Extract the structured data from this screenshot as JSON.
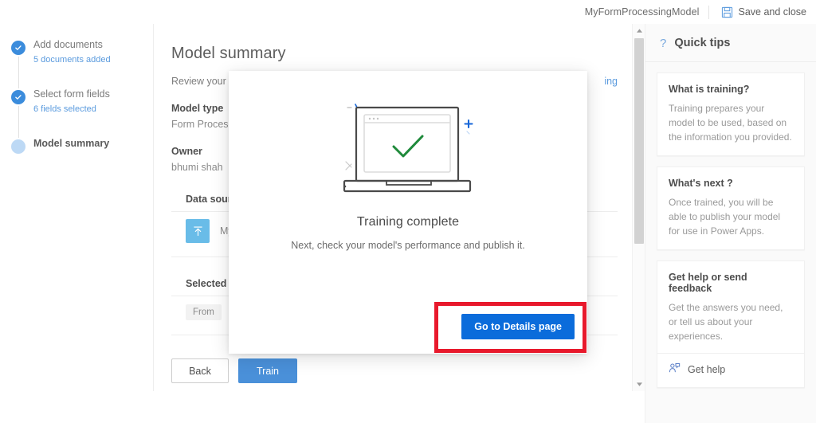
{
  "topbar": {
    "model_name": "MyFormProcessingModel",
    "save_label": "Save and close",
    "save_icon": "save-floppy-icon"
  },
  "wizard": {
    "steps": [
      {
        "title": "Add documents",
        "sub": "5 documents added",
        "state": "complete"
      },
      {
        "title": "Select form fields",
        "sub": "6 fields selected",
        "state": "complete"
      },
      {
        "title": "Model summary",
        "sub": "",
        "state": "current"
      }
    ]
  },
  "main": {
    "heading": "Model summary",
    "review_text": "Review your m",
    "review_link": "ing",
    "model_type_label": "Model type",
    "model_type_value": "Form Process",
    "owner_label": "Owner",
    "owner_value": "bhumi shah",
    "data_source_label": "Data source",
    "data_source_icon": "upload-icon",
    "data_source_value": "My d",
    "selected_fields_label": "Selected field",
    "field_chips": [
      "From"
    ],
    "back_label": "Back",
    "train_label": "Train"
  },
  "scrollbar": {
    "up_icon": "scroll-up-arrow-icon",
    "down_icon": "scroll-down-arrow-icon"
  },
  "tips": {
    "icon": "question-mark-icon",
    "title": "Quick tips",
    "cards": [
      {
        "heading": "What is training?",
        "body": "Training prepares your model to be used, based on the information you provided."
      },
      {
        "heading": "What's next ?",
        "body": "Once trained, you will be able to publish your model for use in Power Apps."
      },
      {
        "heading": "Get help or send feedback",
        "body": "Get the answers you need, or tell us about your experiences.",
        "link_label": "Get help",
        "link_icon": "get-help-person-icon"
      }
    ]
  },
  "modal": {
    "illustration": "laptop-with-checkmark-illustration",
    "title": "Training complete",
    "subtitle": "Next, check your model's performance and publish it.",
    "primary_label": "Go to Details page"
  },
  "colors": {
    "accent_blue": "#0b6cdb",
    "step_blue": "#3b8cdc",
    "link_blue": "#5b9bde",
    "highlight_red": "#e8192c",
    "check_green": "#1f8a3b",
    "upload_tile": "#69bce8"
  }
}
